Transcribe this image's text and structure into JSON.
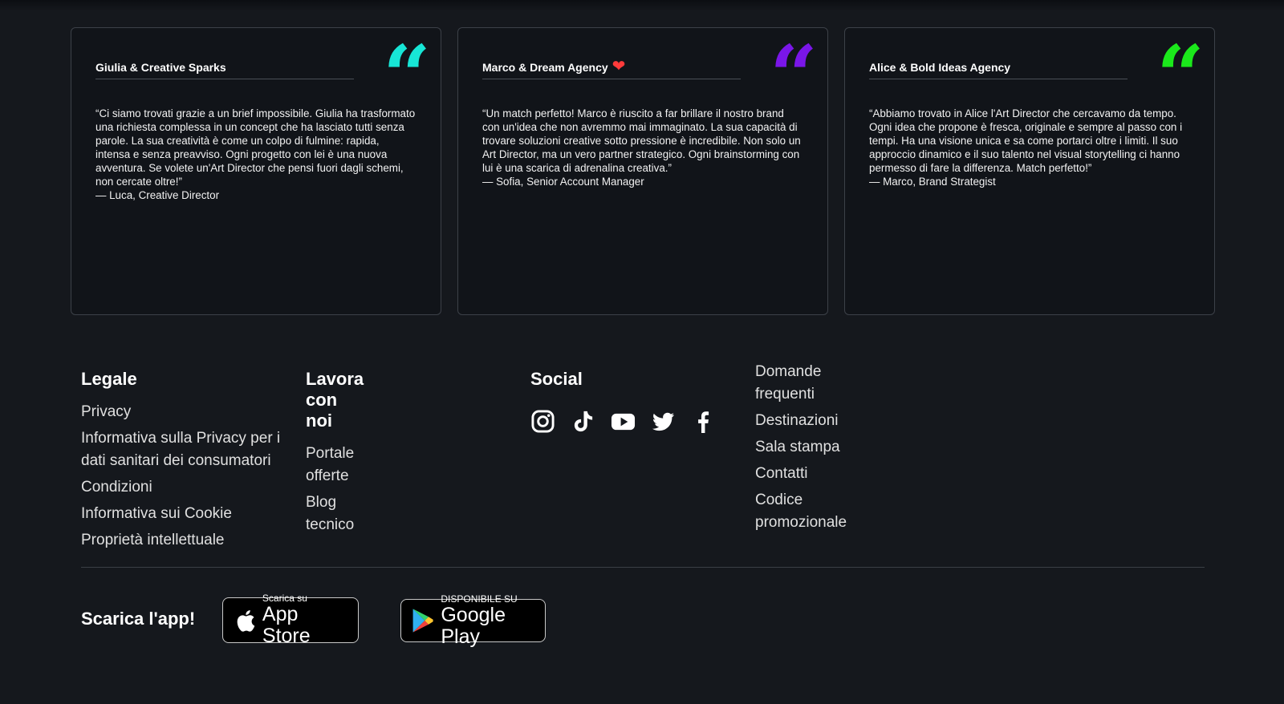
{
  "testimonials": [
    {
      "title": "Giulia & Creative Sparks",
      "heart": "",
      "quote_color": "#17e6d6",
      "quote": "“Ci siamo trovati grazie a un brief impossibile. Giulia ha trasformato una richiesta complessa in un concept che ha lasciato tutti senza parole. La sua creatività è come un colpo di fulmine: rapida, intensa e senza preavviso. Ogni progetto con lei è una nuova avventura. Se volete un'Art Director che pensi fuori dagli schemi, non cercate oltre!”",
      "author": "— Luca, Creative Director"
    },
    {
      "title": "Marco & Dream Agency",
      "heart": "❤",
      "quote_color": "#7a16e8",
      "quote": "“Un match perfetto! Marco è riuscito a far brillare il nostro brand con un'idea che non avremmo mai immaginato. La sua capacità di trovare soluzioni creative sotto pressione è incredibile. Non solo un Art Director, ma un vero partner strategico. Ogni brainstorming con lui è una scarica di adrenalina creativa.”",
      "author": "— Sofia, Senior Account Manager"
    },
    {
      "title": "Alice & Bold Ideas Agency",
      "heart": "",
      "quote_color": "#1be81b",
      "quote": "“Abbiamo trovato in Alice l'Art Director che cercavamo da tempo. Ogni idea che propone è fresca, originale e sempre al passo con i tempi. Ha una visione unica e sa come portarci oltre i limiti. Il suo approccio dinamico e il suo talento nel visual storytelling ci hanno permesso di fare la differenza. Match perfetto!”",
      "author": "— Marco, Brand Strategist"
    }
  ],
  "footer": {
    "legal": {
      "heading": "Legale",
      "links": [
        "Privacy",
        "Informativa sulla Privacy per i dati sanitari dei consumatori",
        "Condizioni",
        "Informativa sui Cookie",
        "Proprietà intellettuale"
      ]
    },
    "work": {
      "heading": "Lavora con noi",
      "links": [
        "Portale offerte",
        "Blog tecnico"
      ]
    },
    "social": {
      "heading": "Social",
      "icons": [
        "instagram-icon",
        "tiktok-icon",
        "youtube-icon",
        "twitter-icon",
        "facebook-icon"
      ]
    },
    "misc_links": [
      "Domande frequenti",
      "Destinazioni",
      "Sala stampa",
      "Contatti",
      "Codice promozionale"
    ]
  },
  "app": {
    "label": "Scarica l'app!",
    "appstore": {
      "small": "Scarica su",
      "big": "App Store"
    },
    "googleplay": {
      "small": "DISPONIBILE SU",
      "big": "Google Play"
    }
  }
}
